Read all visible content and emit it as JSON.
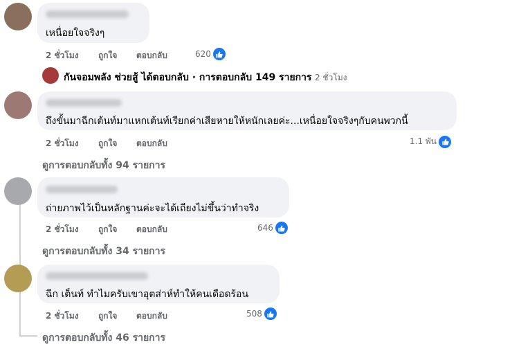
{
  "comments": [
    {
      "text": "เหนื่อยใจจริงๆ",
      "time": "2 ชั่วโมง",
      "like_label": "ถูกใจ",
      "reply_label": "ตอบกลับ",
      "reaction_count": "620",
      "avatar_color": "#8a6f5c"
    },
    {
      "text": "ถึงขั้นมาฉีกเต้นท์มาแหกเต้นท์เรียกค่าเสียหายให้หนักเลยค่ะ...เหนื่อยใจจริงๆกับคนพวกนี้",
      "time": "2 ชั่วโมง",
      "like_label": "ถูกใจ",
      "reply_label": "ตอบกลับ",
      "reaction_count": "1.1 พัน",
      "view_replies": "ดูการตอบกลับทั้ง 94 รายการ",
      "avatar_color": "#9c7a73"
    },
    {
      "text": "ถ่ายภาพไว้เป็นหลักฐานค่ะจะได้เถียงไม่ขึ้นว่าทำจริง",
      "time": "2 ชั่วโมง",
      "like_label": "ถูกใจ",
      "reply_label": "ตอบกลับ",
      "reaction_count": "646",
      "view_replies": "ดูการตอบกลับทั้ง 34 รายการ",
      "avatar_color": "#a7a9ad"
    },
    {
      "text": "ฉีก เต็นท์ ทำไมครับเขาอุตส่าห์ทำให้คนเดือดร้อน",
      "time": "2 ชั่วโมง",
      "like_label": "ถูกใจ",
      "reply_label": "ตอบกลับ",
      "reaction_count": "508",
      "view_replies": "ดูการตอบกลับทั้ง 46 รายการ",
      "avatar_color": "#b49c54"
    }
  ],
  "reply_summary": {
    "name": "กันจอมพลัง ช่วยสู้",
    "action": " ได้ตอบกลับ · การตอบกลับ 149 รายการ",
    "time": "2 ชั่วโมง"
  },
  "colors": {
    "like_blue": "#1877f2",
    "bubble_bg": "#f0f2f5",
    "meta_gray": "#65676b"
  },
  "icons": [
    "like-icon"
  ]
}
